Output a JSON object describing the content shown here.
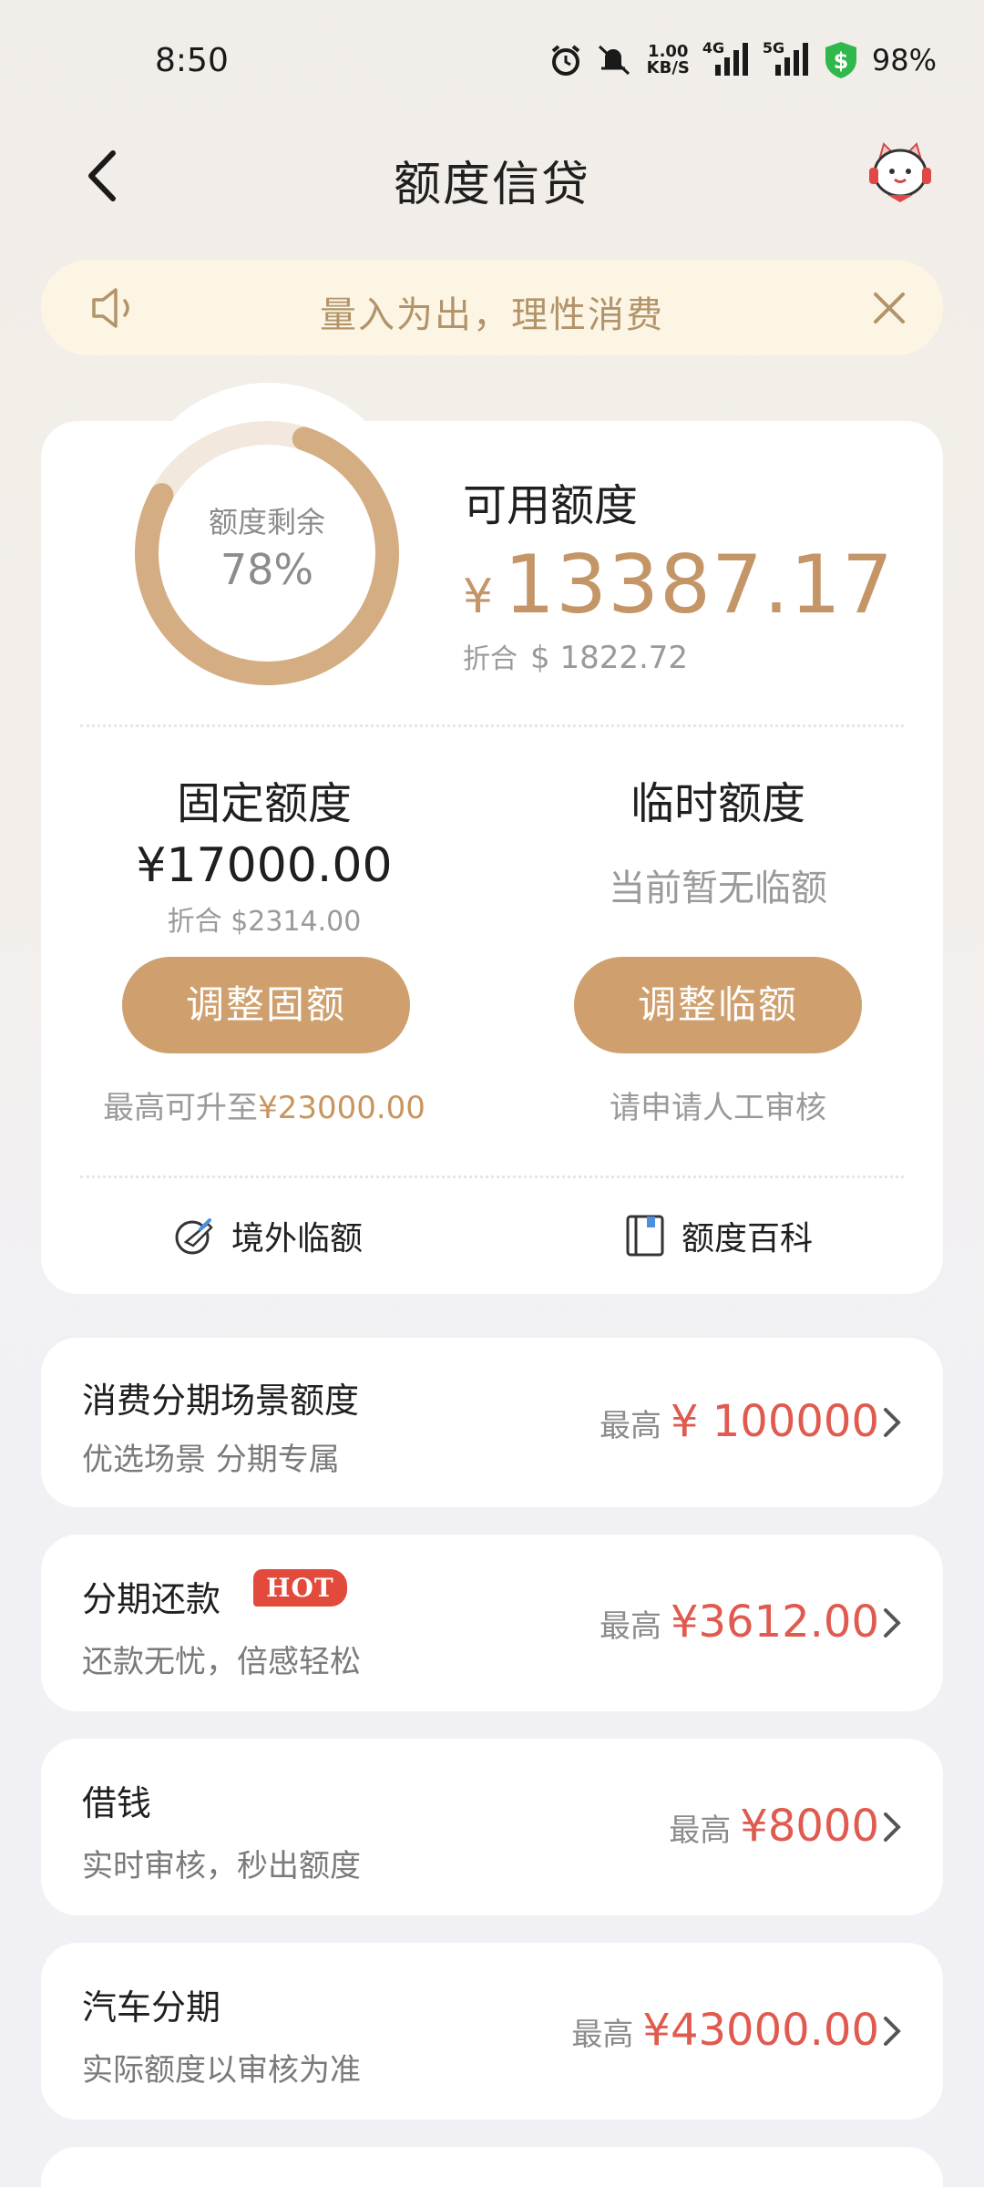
{
  "status_bar": {
    "time": "8:50",
    "net_speed_value": "1.00",
    "net_speed_unit": "KB/S",
    "net_type_1": "4G",
    "net_type_2": "5G",
    "battery": "98%"
  },
  "header": {
    "title": "额度信贷"
  },
  "notice": {
    "text": "量入为出，理性消费"
  },
  "credit": {
    "ring_label": "额度剩余",
    "ring_percent_text": "78%",
    "ring_fraction": 0.78,
    "available_label": "可用额度",
    "currency_symbol": "¥",
    "available_amount": "13387.17",
    "converted_prefix": "折合",
    "converted_value": "$ 1822.72",
    "fixed": {
      "title": "固定额度",
      "value": "¥17000.00",
      "sub": "折合 $2314.00",
      "button": "调整固额",
      "note_prefix": "最高可升至",
      "note_highlight": "¥23000.00"
    },
    "temp": {
      "title": "临时额度",
      "status": "当前暂无临额",
      "button": "调整临额",
      "note": "请申请人工审核"
    },
    "links": {
      "overseas": "境外临额",
      "encyclopedia": "额度百科"
    }
  },
  "products": [
    {
      "title": "消费分期场景额度",
      "subtitle": "优选场景 分期专属",
      "prefix": "最高",
      "amount": "¥ 100000"
    },
    {
      "title": "分期还款",
      "badge": "HOT",
      "subtitle": "还款无忧，倍感轻松",
      "prefix": "最高",
      "amount": "¥3612.00"
    },
    {
      "title": "借钱",
      "subtitle": "实时审核，秒出额度",
      "prefix": "最高",
      "amount": "¥8000"
    },
    {
      "title": "汽车分期",
      "subtitle": "实际额度以审核为准",
      "prefix": "最高",
      "amount": "¥43000.00"
    }
  ],
  "colors": {
    "gold": "#c49566",
    "button": "#cfa06e",
    "red": "#e05a4f",
    "notice_bg": "#fcf5e4"
  }
}
